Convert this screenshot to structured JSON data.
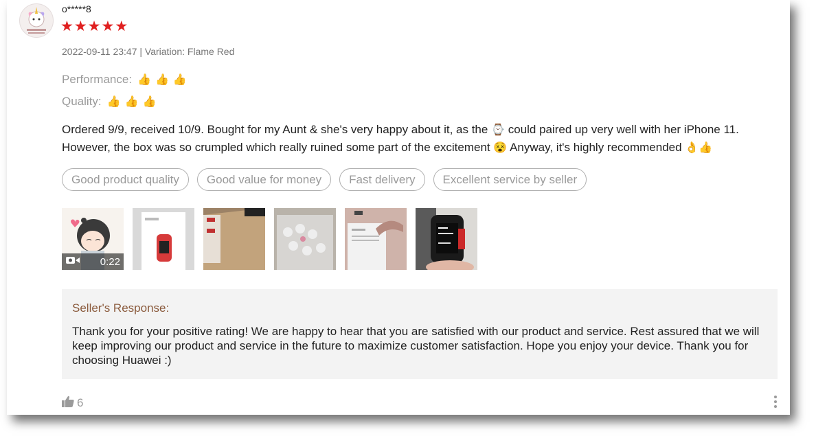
{
  "review": {
    "username": "o*****8",
    "rating": 5,
    "meta": "2022-09-11 23:47 | Variation: Flame Red",
    "attributes": [
      {
        "label": "Performance:",
        "icon": "thumbs-up-icon"
      },
      {
        "label": "Quality:",
        "icon": "thumbs-up-icon"
      }
    ],
    "comment_line1_a": "Ordered 9/9, received 10/9. Bought for my Aunt & she's very happy about it, as the",
    "comment_line1_b": "could paired up very well with her iPhone 11.",
    "comment_line2_a": "However, the box was so crumpled which really ruined some part of the excitement",
    "comment_line2_b": "Anyway, it's highly recommended",
    "tags": [
      "Good product quality",
      "Good value for money",
      "Fast delivery",
      "Excellent service by seller"
    ],
    "video_duration": "0:22",
    "likes": "6"
  },
  "seller_response": {
    "title": "Seller's Response:",
    "text": "Thank you for your positive rating! We are happy to hear that you are satisfied with our product and service. Rest assured that we will keep improving our product and service in the future to maximize customer satisfaction. Hope you enjoy your device. Thank you for choosing Huawei :)"
  },
  "colors": {
    "star": "#e02020",
    "response_title": "#8a5a3c",
    "response_bg": "#f3f3f3"
  }
}
